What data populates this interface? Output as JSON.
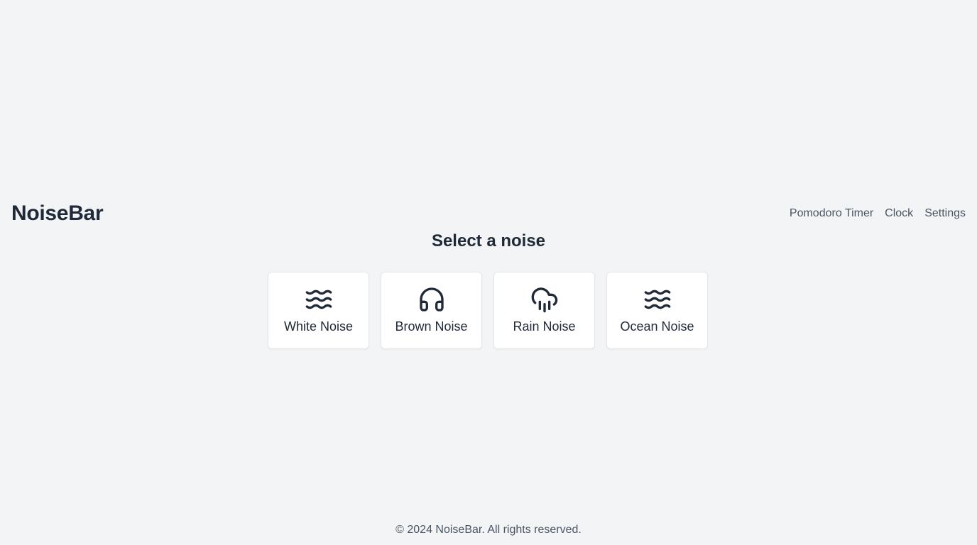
{
  "app": {
    "brand": "NoiseBar"
  },
  "nav": {
    "items": [
      {
        "label": "Pomodoro Timer"
      },
      {
        "label": "Clock"
      },
      {
        "label": "Settings"
      }
    ]
  },
  "main": {
    "heading": "Select a noise",
    "noises": [
      {
        "label": "White Noise",
        "icon": "waves-icon"
      },
      {
        "label": "Brown Noise",
        "icon": "headphones-icon"
      },
      {
        "label": "Rain Noise",
        "icon": "cloud-rain-icon"
      },
      {
        "label": "Ocean Noise",
        "icon": "waves-icon"
      }
    ]
  },
  "footer": {
    "text": "© 2024 NoiseBar. All rights reserved."
  },
  "colors": {
    "background": "#f3f4f6",
    "text_primary": "#1f2937",
    "text_secondary": "#4b5563",
    "card_background": "#ffffff",
    "card_border": "#e5e7eb"
  }
}
